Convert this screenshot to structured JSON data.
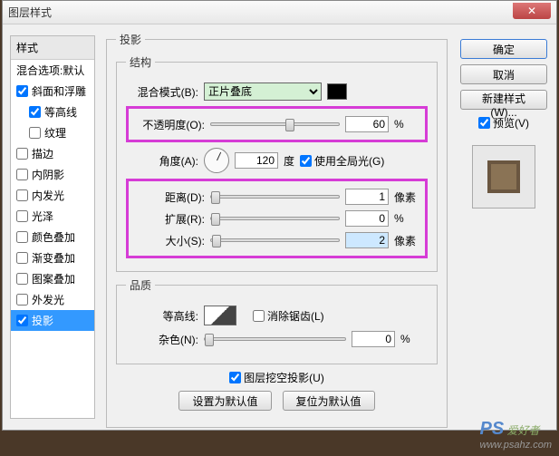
{
  "title": "图层样式",
  "styles_header": "样式",
  "styles": [
    {
      "label": "混合选项:默认",
      "checked": false,
      "noCheck": true
    },
    {
      "label": "斜面和浮雕",
      "checked": true
    },
    {
      "label": "等高线",
      "checked": true,
      "indent": true
    },
    {
      "label": "纹理",
      "checked": false,
      "indent": true
    },
    {
      "label": "描边",
      "checked": false
    },
    {
      "label": "内阴影",
      "checked": false
    },
    {
      "label": "内发光",
      "checked": false
    },
    {
      "label": "光泽",
      "checked": false
    },
    {
      "label": "颜色叠加",
      "checked": false
    },
    {
      "label": "渐变叠加",
      "checked": false
    },
    {
      "label": "图案叠加",
      "checked": false
    },
    {
      "label": "外发光",
      "checked": false
    },
    {
      "label": "投影",
      "checked": true,
      "selected": true
    }
  ],
  "main_header": "投影",
  "group1": "结构",
  "blend_label": "混合模式(B):",
  "blend_value": "正片叠底",
  "opacity_label": "不透明度(O):",
  "opacity_value": "60",
  "pct": "%",
  "angle_label": "角度(A):",
  "angle_value": "120",
  "deg": "度",
  "global_light": "使用全局光(G)",
  "distance_label": "距离(D):",
  "distance_value": "1",
  "px": "像素",
  "spread_label": "扩展(R):",
  "spread_value": "0",
  "size_label": "大小(S):",
  "size_value": "2",
  "group2": "品质",
  "contour_label": "等高线:",
  "antialias": "消除锯齿(L)",
  "noise_label": "杂色(N):",
  "noise_value": "0",
  "knockout": "图层挖空投影(U)",
  "make_default": "设置为默认值",
  "reset_default": "复位为默认值",
  "ok": "确定",
  "cancel": "取消",
  "new_style": "新建样式(W)...",
  "preview": "预览(V)",
  "watermark_site": "www.psahz.com",
  "watermark_brand": "PS",
  "watermark_cn": "爱好者"
}
